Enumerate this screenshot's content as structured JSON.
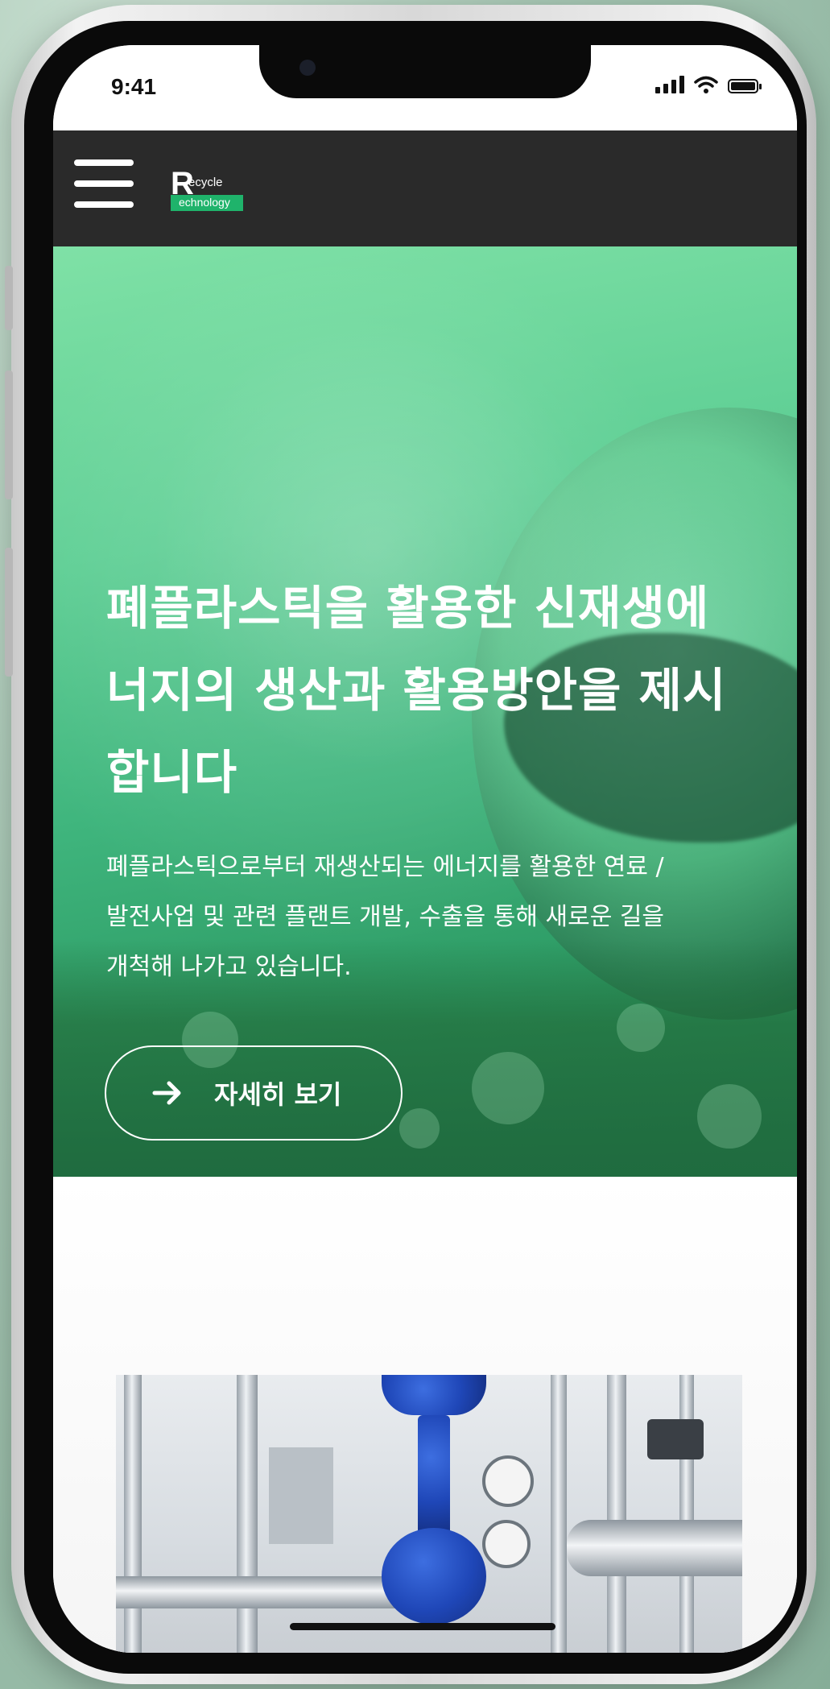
{
  "status_bar": {
    "time": "9:41"
  },
  "header": {
    "logo": {
      "letter": "R",
      "word1": "ecycle",
      "word2": "echnology"
    },
    "menu_icon": "hamburger-icon"
  },
  "hero": {
    "title": "폐플라스틱을 활용한 신재생에\n너지의 생산과 활용방안을 제시\n합니다",
    "description": "폐플라스틱으로부터 재생산되는 에너지를 활용한 연료 /\n발전사업 및 관련 플랜트 개발, 수출을 통해 새로운 길을\n개척해 나가고 있습니다.",
    "button_label": "자세히 보기",
    "button_icon": "arrow-right-icon"
  },
  "colors": {
    "header_bg": "#2a2a2a",
    "hero_green": "#4cc486",
    "logo_green": "#1fb36b",
    "valve_blue": "#1f47b8"
  }
}
